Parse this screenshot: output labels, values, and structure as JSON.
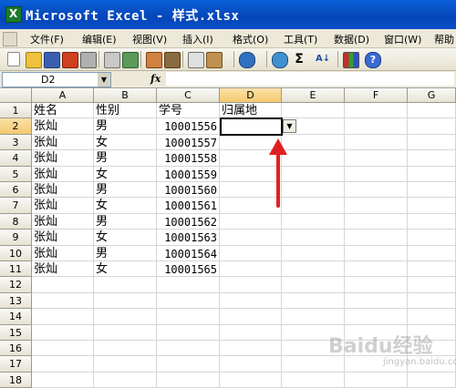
{
  "window": {
    "title": "Microsoft Excel - 样式.xlsx"
  },
  "menu": [
    "文件(F)",
    "编辑(E)",
    "视图(V)",
    "插入(I)",
    "格式(O)",
    "工具(T)",
    "数据(D)",
    "窗口(W)",
    "帮助"
  ],
  "toolbar_icons": [
    "new-icon",
    "open-icon",
    "save-icon",
    "permission-icon",
    "print-icon",
    "print-preview-icon",
    "spelling-icon",
    "research-icon",
    "cut-icon",
    "copy-icon",
    "paste-icon",
    "undo-icon",
    "hyperlink-icon",
    "autosum-icon",
    "sort-icon",
    "chart-icon",
    "help-icon"
  ],
  "namebox": {
    "value": "D2"
  },
  "fx_label": "fx",
  "columns": [
    "A",
    "B",
    "C",
    "D",
    "E",
    "F",
    "G"
  ],
  "rows": [
    "1",
    "2",
    "3",
    "4",
    "5",
    "6",
    "7",
    "8",
    "9",
    "10",
    "11",
    "12",
    "13",
    "14",
    "15",
    "16",
    "17",
    "18"
  ],
  "headers": {
    "name": "姓名",
    "gender": "性别",
    "id": "学号",
    "place": "归属地"
  },
  "records": [
    {
      "name": "张灿",
      "gender": "男",
      "id": "10001556"
    },
    {
      "name": "张灿",
      "gender": "女",
      "id": "10001557"
    },
    {
      "name": "张灿",
      "gender": "男",
      "id": "10001558"
    },
    {
      "name": "张灿",
      "gender": "女",
      "id": "10001559"
    },
    {
      "name": "张灿",
      "gender": "男",
      "id": "10001560"
    },
    {
      "name": "张灿",
      "gender": "女",
      "id": "10001561"
    },
    {
      "name": "张灿",
      "gender": "男",
      "id": "10001562"
    },
    {
      "name": "张灿",
      "gender": "女",
      "id": "10001563"
    },
    {
      "name": "张灿",
      "gender": "男",
      "id": "10001564"
    },
    {
      "name": "张灿",
      "gender": "女",
      "id": "10001565"
    }
  ],
  "colors": {
    "titlebar": "#0a5fd8",
    "arrow": "#e02020",
    "selection_header": "#f3c96e"
  },
  "watermark": {
    "text": "Baidu经验",
    "sub": "jingyan.baidu.com"
  }
}
